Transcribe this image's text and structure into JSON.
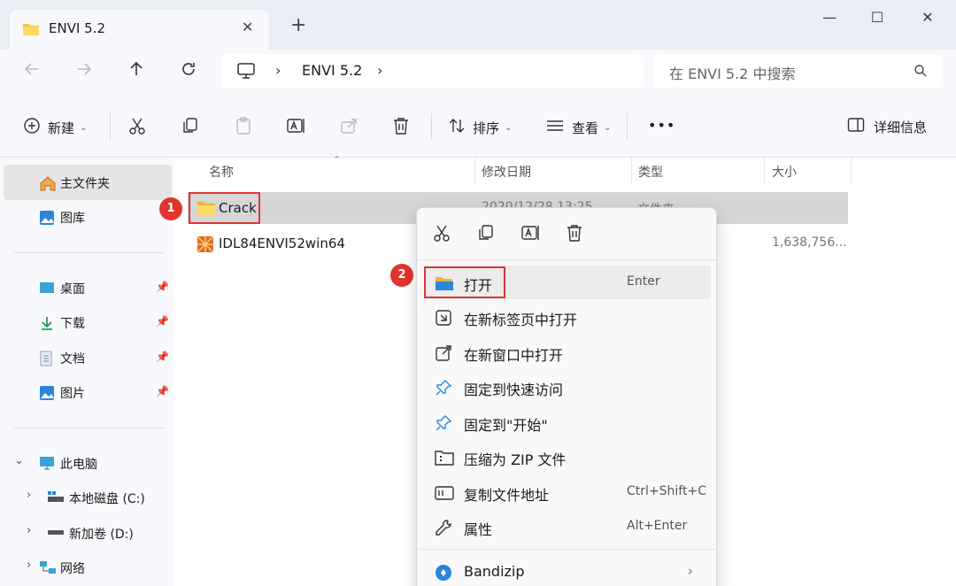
{
  "window": {
    "tab_title": "ENVI 5.2",
    "tab_close": "✕",
    "new_tab": "+",
    "minimize": "—",
    "maximize": "☐",
    "close": "✕"
  },
  "address": {
    "crumb": "ENVI 5.2",
    "separator": "›",
    "search_placeholder": "在 ENVI 5.2 中搜索"
  },
  "toolbar": {
    "new_label": "新建",
    "sort_label": "排序",
    "view_label": "查看",
    "more_label": "•••",
    "details_label": "详细信息",
    "caret": "⌄"
  },
  "sidebar": {
    "items": [
      {
        "label": "主文件夹",
        "icon": "home-icon"
      },
      {
        "label": "图库",
        "icon": "gallery-icon"
      },
      {
        "label": "桌面",
        "icon": "desktop-icon",
        "pinned": true
      },
      {
        "label": "下载",
        "icon": "download-icon",
        "pinned": true
      },
      {
        "label": "文档",
        "icon": "document-icon",
        "pinned": true
      },
      {
        "label": "图片",
        "icon": "pictures-icon",
        "pinned": true
      },
      {
        "label": "此电脑",
        "icon": "this-pc-icon"
      },
      {
        "label": "本地磁盘 (C:)",
        "icon": "drive-c-icon"
      },
      {
        "label": "新加卷 (D:)",
        "icon": "drive-d-icon"
      },
      {
        "label": "网络",
        "icon": "network-icon"
      }
    ],
    "pin_glyph": "📌",
    "expanded": "⌄",
    "collapsed": "›"
  },
  "columns": {
    "name": "名称",
    "modified": "修改日期",
    "type": "类型",
    "size": "大小",
    "sort_glyph": "⌃"
  },
  "files": [
    {
      "name": "Crack",
      "modified": "2020/12/28 13:25",
      "type": "文件夹",
      "size": ""
    },
    {
      "name": "IDL84ENVI52win64",
      "modified": "",
      "type": "",
      "size": "1,638,756..."
    }
  ],
  "markers": {
    "first": "1",
    "second": "2"
  },
  "context_menu": {
    "items": [
      {
        "label": "打开",
        "shortcut": "Enter",
        "icon": "open-folder-icon"
      },
      {
        "label": "在新标签页中打开",
        "shortcut": "",
        "icon": "new-tab-icon"
      },
      {
        "label": "在新窗口中打开",
        "shortcut": "",
        "icon": "new-window-icon"
      },
      {
        "label": "固定到快速访问",
        "shortcut": "",
        "icon": "pin-icon"
      },
      {
        "label": "固定到\"开始\"",
        "shortcut": "",
        "icon": "pin-start-icon"
      },
      {
        "label": "压缩为 ZIP 文件",
        "shortcut": "",
        "icon": "zip-icon"
      },
      {
        "label": "复制文件地址",
        "shortcut": "Ctrl+Shift+C",
        "icon": "copy-path-icon"
      },
      {
        "label": "属性",
        "shortcut": "Alt+Enter",
        "icon": "properties-icon"
      },
      {
        "label": "Bandizip",
        "shortcut": "",
        "icon": "bandizip-icon",
        "submenu": "›"
      }
    ]
  },
  "colors": {
    "accent": "#0067c0",
    "highlight": "#e0342f",
    "folder": "#f4c542"
  }
}
